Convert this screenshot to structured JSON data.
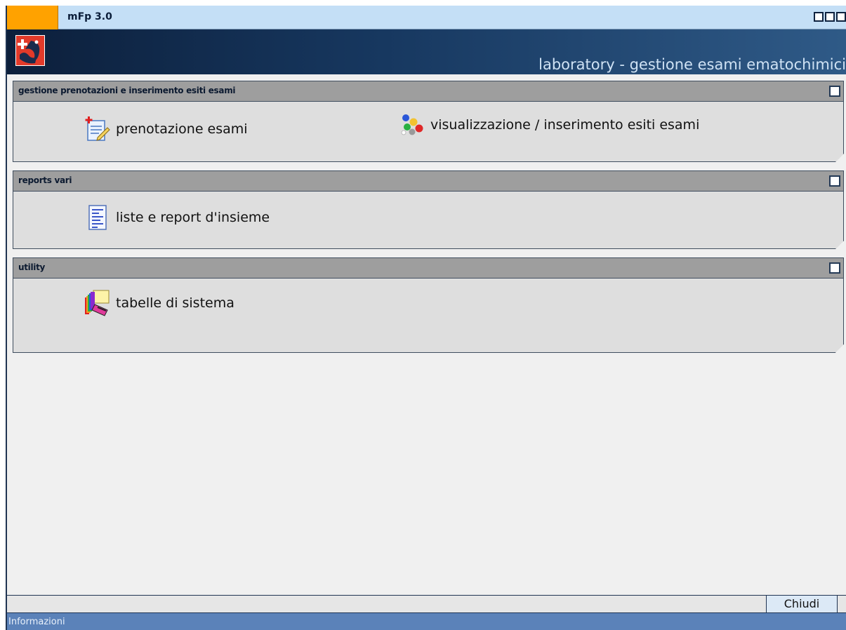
{
  "app": {
    "title": "mFp 3.0",
    "subtitle": "laboratory - gestione esami ematochimici"
  },
  "sections": [
    {
      "title": "gestione prenotazioni e inserimento esiti esami",
      "items": [
        {
          "label": "prenotazione esami",
          "icon": "notepad-add-icon"
        },
        {
          "label": "visualizzazione / inserimento esiti esami",
          "icon": "test-tubes-icon"
        }
      ]
    },
    {
      "title": "reports vari",
      "items": [
        {
          "label": "liste e report d'insieme",
          "icon": "document-list-icon"
        }
      ]
    },
    {
      "title": "utility",
      "items": [
        {
          "label": "tabelle di sistema",
          "icon": "system-tables-icon"
        }
      ]
    }
  ],
  "footer": {
    "close_label": "Chiudi",
    "status": "Informazioni"
  },
  "colors": {
    "accent_tab": "#ffa200",
    "titlebar": "#c4dff6",
    "header_dark": "#0c1f3b",
    "section_head": "#9e9e9e",
    "status_bar": "#5b82b9"
  }
}
